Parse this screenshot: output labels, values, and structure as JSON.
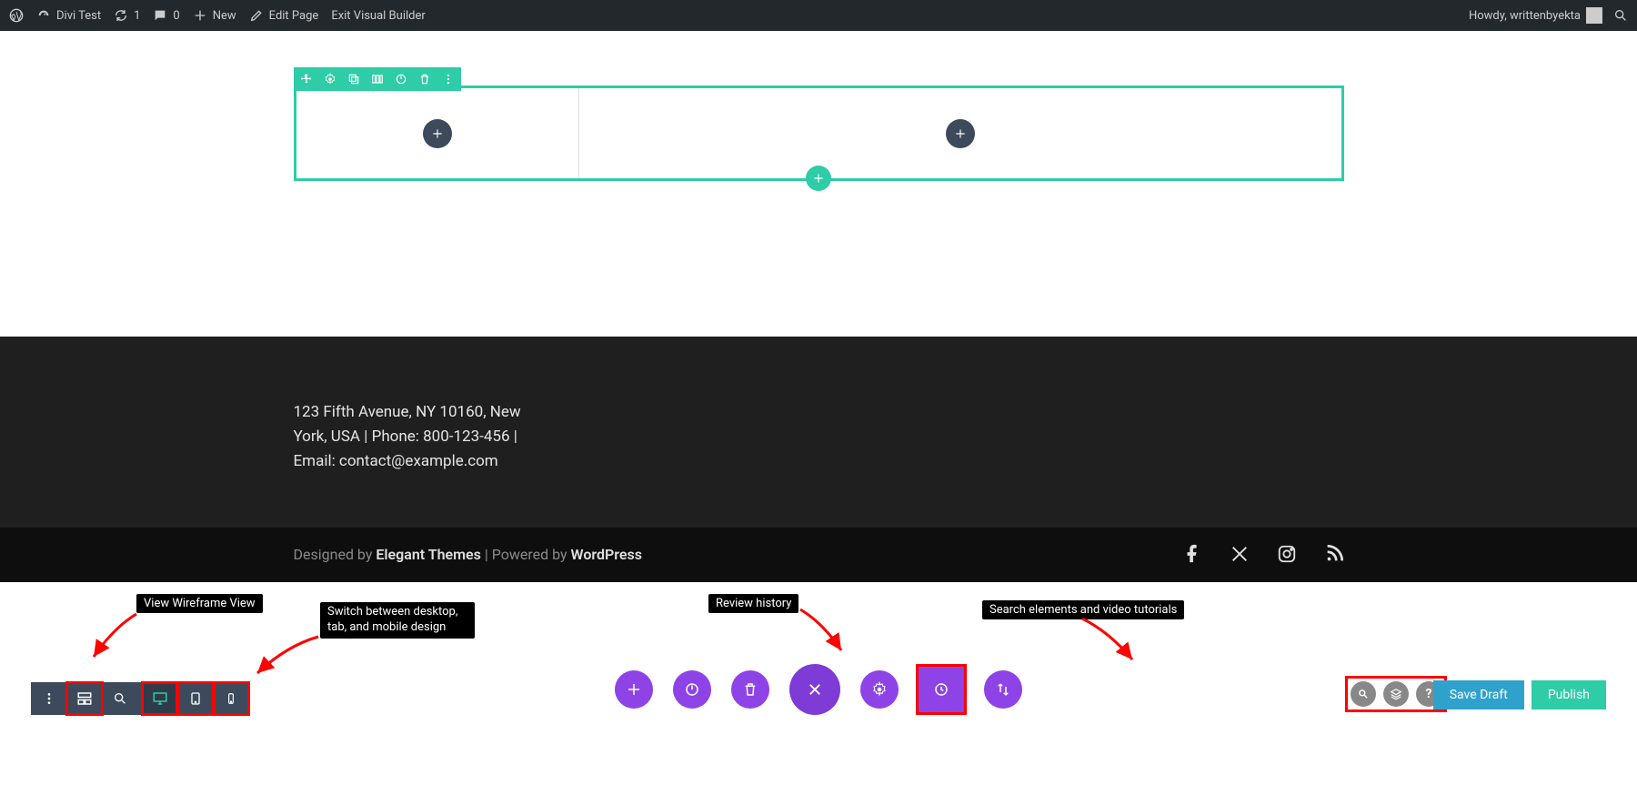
{
  "admin_bar": {
    "site_name": "Divi Test",
    "updates_count": "1",
    "comments_count": "0",
    "new_label": "New",
    "edit_page_label": "Edit Page",
    "exit_vb_label": "Exit Visual Builder",
    "howdy": "Howdy, writtenbyekta"
  },
  "footer": {
    "text": "123 Fifth Avenue, NY 10160, New York, USA | Phone: 800-123-456 | Email: contact@example.com"
  },
  "sub_footer": {
    "prefix": "Designed by ",
    "theme": "Elegant Themes",
    "mid": " | Powered by ",
    "platform": "WordPress"
  },
  "annotations": {
    "wireframe": "View Wireframe View",
    "device": "Switch between desktop, tab, and mobile design",
    "history": "Review history",
    "search": "Search elements and video tutorials"
  },
  "buttons": {
    "save_draft": "Save Draft",
    "publish": "Publish"
  }
}
